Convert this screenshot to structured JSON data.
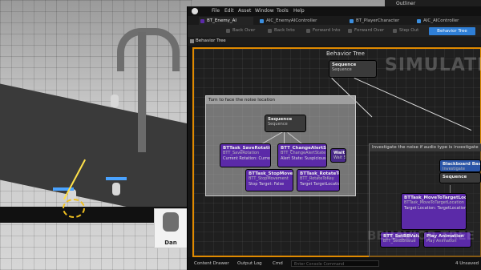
{
  "outliner": {
    "title": "Outliner"
  },
  "menu": {
    "items": [
      "File",
      "Edit",
      "Asset",
      "Window",
      "Tools",
      "Help"
    ]
  },
  "tabs": [
    "BT_Enemy_AI",
    "AIC_EnemyAIController",
    "BT_PlayerCharacter",
    "AIC_AIController"
  ],
  "toolbar": {
    "buttons": [
      "Back Over",
      "Back Into",
      "Forward Into",
      "Forward Over",
      "Step Out"
    ],
    "behavior_tree": "Behavior Tree"
  },
  "subtab": "Behavior Tree",
  "graph": {
    "title": "Behavior Tree",
    "simulating": "SIMULATING",
    "watermark": "BEHAVIOR TREE",
    "comment_left": "Turn to face the noise location",
    "comment_right": "Investigate the noise if audio type is investigate"
  },
  "nodes": {
    "root": {
      "title": "Sequence",
      "sub": "Sequence"
    },
    "seq_left": {
      "title": "Sequence",
      "sub": "Sequence"
    },
    "save_rotation": {
      "title": "BTTask_SaveRotation",
      "sub": "BTT_SaveRotation",
      "body": "Current Rotation: CurrentRotation"
    },
    "change_alert": {
      "title": "BTT_ChangeAlertState",
      "sub": "BTT_ChangeAlertState",
      "body": "Alert State: Suspicious"
    },
    "wait": {
      "title": "Wait",
      "sub": "Wait 5s"
    },
    "stop_movement": {
      "title": "BTTask_StopMovement",
      "sub": "BTT_StopMovement",
      "body": "Stop Target: False"
    },
    "rotate_to_key": {
      "title": "BTTask_RotateToKey",
      "sub": "BTT_RotateToKey",
      "body": "Target TargetLocation"
    },
    "blackboard": {
      "title": "Blackboard Based",
      "sub": "Investigate"
    },
    "seq_right": {
      "title": "Sequence",
      "sub": "Sequence"
    },
    "move_to": {
      "title": "BTTask_MoveToTargetLocation",
      "sub": "BTTask_MoveToTargetLocation",
      "body": "Target Location: TargetLocation"
    },
    "set_bb": {
      "title": "BTT_SetBBValue",
      "sub": "BTT_SetBBValue"
    },
    "play_anim": {
      "title": "Play Animation",
      "sub": "Play Animation"
    }
  },
  "statusbar": {
    "content_drawer": "Content Drawer",
    "output_log": "Output Log",
    "cmd": "Cmd",
    "console_placeholder": "Enter Console Command",
    "unsaved": "4 Unsaved"
  },
  "viewport": {
    "player_name": "Dan"
  },
  "colors": {
    "accent": "#2f7fd6",
    "debug_border": "#e08a00",
    "task": "#5b2aa8"
  }
}
